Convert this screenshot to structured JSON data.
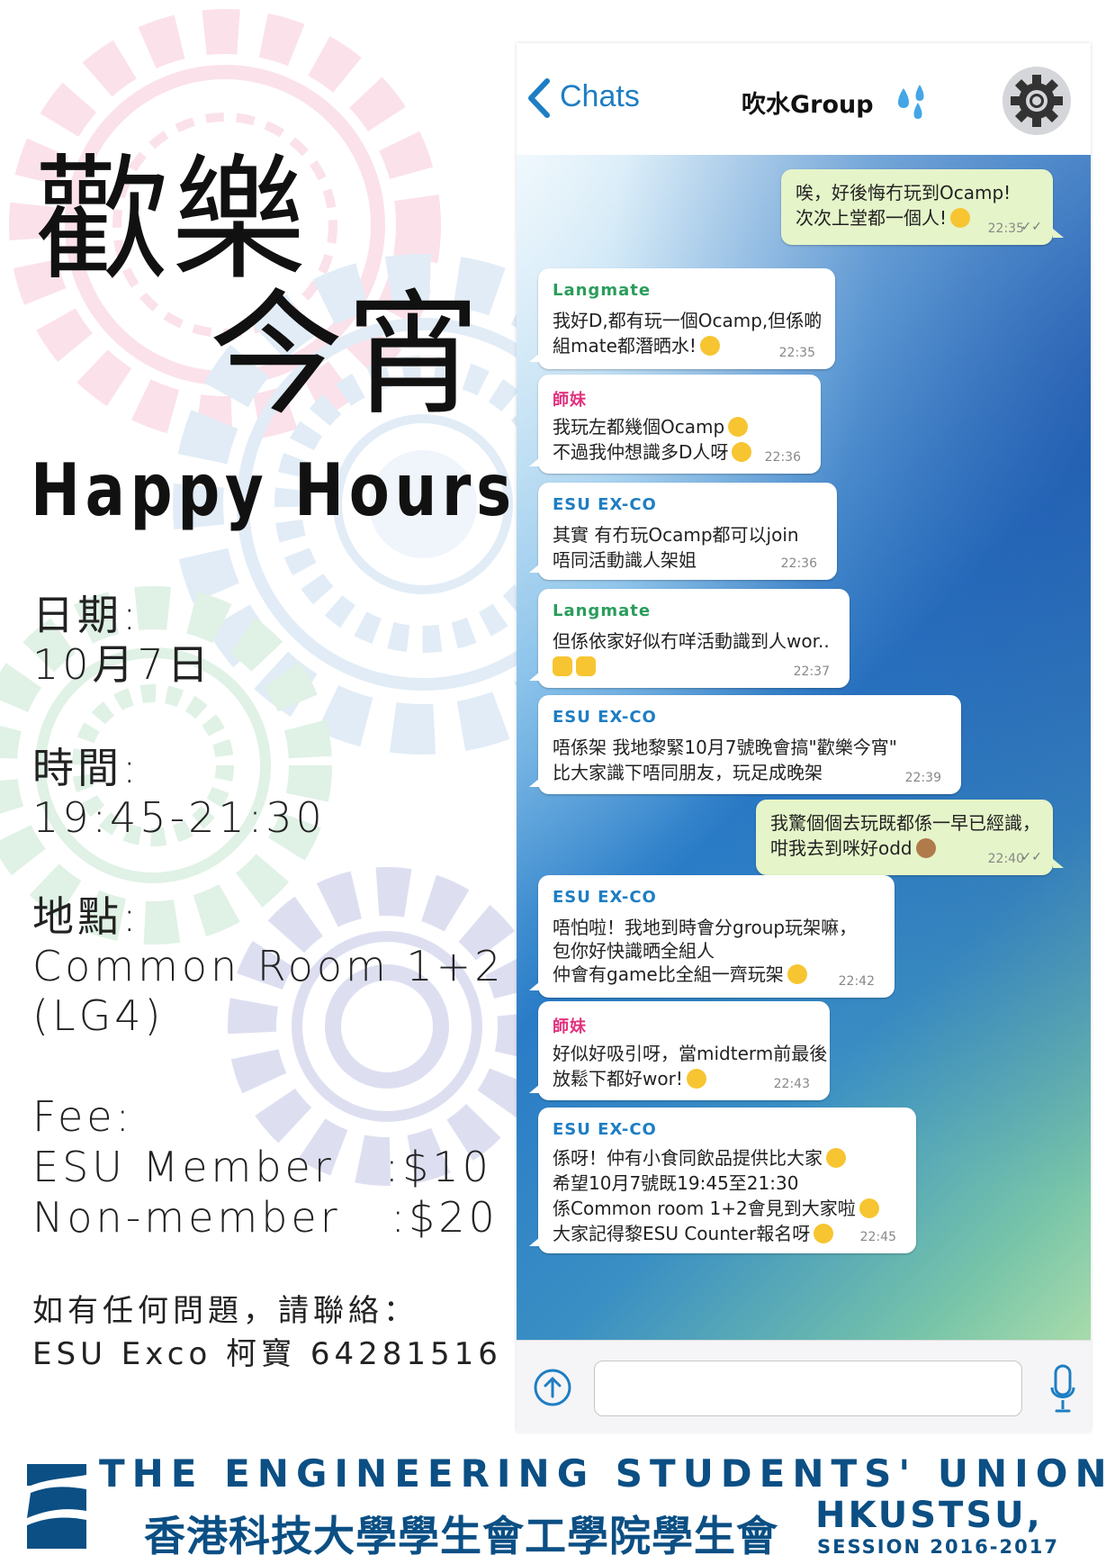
{
  "poster": {
    "title_zh_1": "歡樂",
    "title_zh_2": "今宵",
    "title_en": "Happy Hours",
    "date_label": "日期:",
    "date_value": "10月7日",
    "time_label": "時間:",
    "time_value": "19:45-21:30",
    "venue_label": "地點:",
    "venue_value": "Common Room 1+2",
    "venue_room": "(LG4)",
    "fee_label": "Fee:",
    "fee_member": "ESU Member   :$10",
    "fee_nonmember": "Non-member   :$20",
    "contact_line1": "如有任何問題，請聯絡：",
    "contact_line2": "ESU Exco 柯寶 64281516"
  },
  "chat": {
    "back_label": "Chats",
    "group_title": "吹水Group",
    "header_icons": [
      "chevron-left-icon",
      "water-drops-icon",
      "gear-icon"
    ],
    "messages": [
      {
        "direction": "out",
        "lines": [
          "唉，好後悔冇玩到Ocamp!",
          "次次上堂都一個人!"
        ],
        "time": "22:35"
      },
      {
        "direction": "in",
        "sender": "Langmate",
        "lines": [
          "我好D,都有玩一個Ocamp,但係啲",
          "組mate都潛晒水!"
        ],
        "time": "22:35"
      },
      {
        "direction": "in",
        "sender": "師妹",
        "lines": [
          "我玩左都幾個Ocamp",
          "不過我仲想識多D人呀"
        ],
        "time": "22:36"
      },
      {
        "direction": "in",
        "sender": "ESU EX-CO",
        "lines": [
          "其實 有冇玩Ocamp都可以join",
          "唔同活動識人架姐"
        ],
        "time": "22:36"
      },
      {
        "direction": "in",
        "sender": "Langmate",
        "lines": [
          "但係依家好似冇咩活動識到人wor..",
          ""
        ],
        "time": "22:37"
      },
      {
        "direction": "in",
        "sender": "ESU EX-CO",
        "lines": [
          "唔係架 我地黎緊10月7號晚會搞\"歡樂今宵\"",
          "比大家識下唔同朋友，玩足成晚架"
        ],
        "time": "22:39"
      },
      {
        "direction": "out",
        "lines": [
          "我驚個個去玩既都係一早已經識，",
          "咁我去到咪好odd"
        ],
        "time": "22:40"
      },
      {
        "direction": "in",
        "sender": "ESU EX-CO",
        "lines": [
          "唔怕啦！我地到時會分group玩架嘛，",
          "包你好快識晒全組人",
          "仲會有game比全組一齊玩架"
        ],
        "time": "22:42"
      },
      {
        "direction": "in",
        "sender": "師妹",
        "lines": [
          "好似好吸引呀，當midterm前最後",
          "放鬆下都好wor!"
        ],
        "time": "22:43"
      },
      {
        "direction": "in",
        "sender": "ESU EX-CO",
        "lines": [
          "係呀！仲有小食同飲品提供比大家",
          "希望10月7號既19:45至21:30",
          "係Common room 1+2會見到大家啦",
          "大家記得黎ESU Counter報名呀"
        ],
        "time": "22:45"
      }
    ],
    "sender_colors": {
      "Langmate": "#2a9d5c",
      "師妹": "#e0337f",
      "ESU EX-CO": "#1e7ec3"
    },
    "input_placeholder": "",
    "bottom_icons": [
      "upload-icon",
      "microphone-icon"
    ]
  },
  "footer": {
    "line1": "THE ENGINEERING STUDENTS' UNION,",
    "line2": "香港科技大學學生會工學院學生會",
    "hk": "HKUSTSU,",
    "session": "SESSION 2016-2017",
    "color": "#0b4f84"
  }
}
